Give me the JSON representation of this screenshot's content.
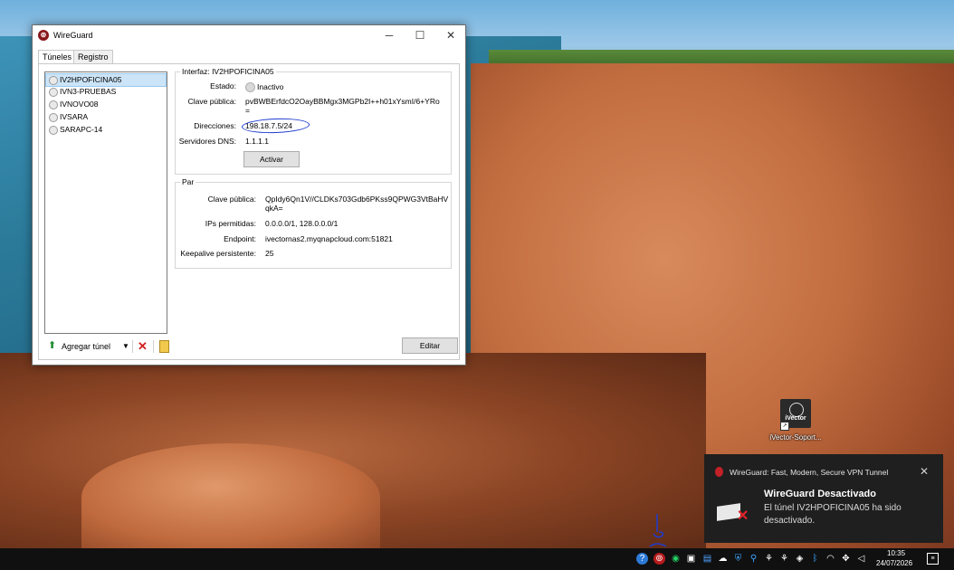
{
  "window": {
    "title": "WireGuard",
    "icon": "wireguard-dragon-icon"
  },
  "tabs": [
    "Túneles",
    "Registro"
  ],
  "tunnels": [
    {
      "name": "IV2HPOFICINA05",
      "selected": true
    },
    {
      "name": "IVN3-PRUEBAS"
    },
    {
      "name": "IVNOVO08"
    },
    {
      "name": "IVSARA"
    },
    {
      "name": "SARAPC-14"
    }
  ],
  "toolbar": {
    "add_label": "Agregar túnel",
    "edit_label": "Editar"
  },
  "interface": {
    "header": "Interfaz: IV2HPOFICINA05",
    "status_label": "Estado:",
    "status_value": "Inactivo",
    "pubkey_label": "Clave pública:",
    "pubkey_line1": "pvBWBErfdcO2OayBBMgx3MGPb2I++h01xYsmI/6+YRo",
    "pubkey_line2": "=",
    "addresses_label": "Direcciones:",
    "addresses_value": "198.18.7.5/24",
    "dns_label": "Servidores DNS:",
    "dns_value": "1.1.1.1",
    "activate_label": "Activar"
  },
  "peer": {
    "header": "Par",
    "pubkey_label": "Clave pública:",
    "pubkey_line1": "QpIdy6Qn1V//CLDKs703Gdb6PKss9QPWG3VtBaHV",
    "pubkey_line2": "qkA=",
    "allowed_ips_label": "IPs permitidas:",
    "allowed_ips_value": "0.0.0.0/1, 128.0.0.0/1",
    "endpoint_label": "Endpoint:",
    "endpoint_value": "ivectornas2.myqnapcloud.com:51821",
    "keepalive_label": "Keepalive persistente:",
    "keepalive_value": "25"
  },
  "desktop": {
    "shortcut_icon_text": "iVector",
    "shortcut_label": "iVector-Soport..."
  },
  "toast": {
    "app": "WireGuard: Fast, Modern, Secure VPN Tunnel",
    "title": "WireGuard Desactivado",
    "message": "El túnel IV2HPOFICINA05 ha sido desactivado."
  },
  "taskbar": {
    "time": "10:35",
    "date": "24/07/2026"
  },
  "colors": {
    "annotation": "#1e3ccf",
    "wireguard_red": "#88171a",
    "selected_bg": "#cce4f7"
  }
}
